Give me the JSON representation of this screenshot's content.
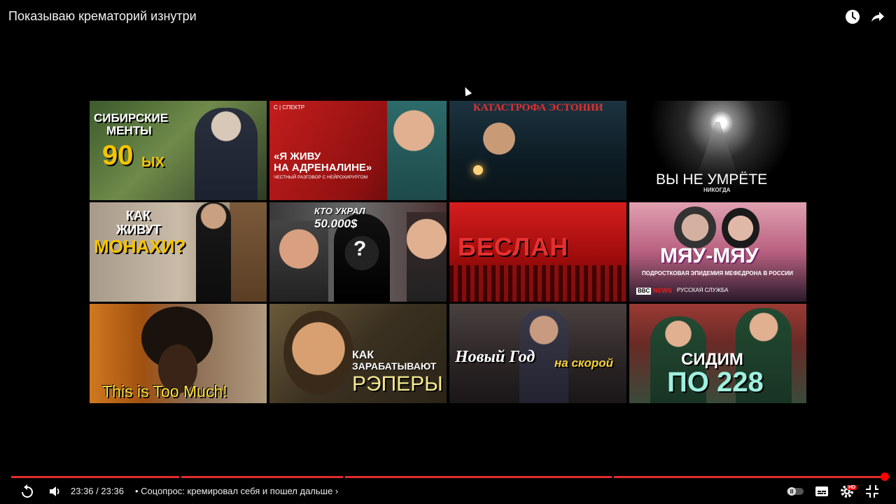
{
  "video": {
    "title": "Показываю крематорий изнутри"
  },
  "top_actions": {
    "watch_later_icon": "clock-icon",
    "share_icon": "share-arrow-icon"
  },
  "endscreen": {
    "tiles": [
      {
        "lines": [
          "СИБИРСКИЕ",
          "МЕНТЫ",
          "90",
          "ЫХ"
        ]
      },
      {
        "lines": [
          "С | СПЕКТР",
          "«Я ЖИВУ",
          "НА АДРЕНАЛИНЕ»",
          "ЧЕСТНЫЙ РАЗГОВОР С НЕЙРОХИРУРГОМ"
        ]
      },
      {
        "lines": [
          "КАТАСТРОФА ЭСТОНИИ"
        ]
      },
      {
        "lines": [
          "ВЫ НЕ УМРЁТЕ",
          "НИКОГДА"
        ]
      },
      {
        "lines": [
          "КАК",
          "ЖИВУТ",
          "МОНАХИ?"
        ]
      },
      {
        "lines": [
          "КТО УКРАЛ",
          "50.000$",
          "?"
        ]
      },
      {
        "lines": [
          "БЕСЛАН"
        ]
      },
      {
        "lines": [
          "МЯУ-МЯУ",
          "ПОДРОСТКОВАЯ ЭПИДЕМИЯ МЕФЕДРОНА В РОССИИ",
          "BBC",
          "NEWS",
          "РУССКАЯ СЛУЖБА"
        ]
      },
      {
        "lines": [
          "This is Too Much!"
        ]
      },
      {
        "lines": [
          "КАК",
          "ЗАРАБАТЫВАЮТ",
          "РЭПЕРЫ"
        ]
      },
      {
        "lines": [
          "Новый Год",
          "на скорой"
        ]
      },
      {
        "lines": [
          "СИДИМ",
          "ПО 228"
        ]
      }
    ]
  },
  "player": {
    "time_current": "23:36",
    "time_separator": " / ",
    "time_total": "23:36",
    "chapter_title": "• Соцопрос: кремировал себя и пошел дальше ›",
    "played_fraction": 1.0,
    "hd_badge": "HD",
    "colors": {
      "progress": "#e32b2b",
      "scrubber": "#ff0000"
    }
  }
}
